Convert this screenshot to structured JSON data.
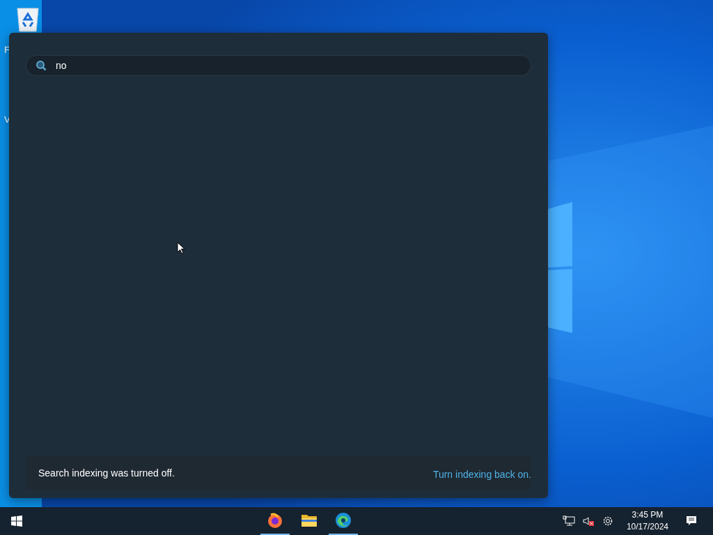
{
  "desktop": {
    "icons": [
      {
        "label": "F"
      },
      {
        "label": "V"
      }
    ]
  },
  "search_panel": {
    "query": "no",
    "notice": "Search indexing was turned off.",
    "link": "Turn indexing back on."
  },
  "taskbar": {
    "apps": [
      {
        "kind": "firefox",
        "running": true
      },
      {
        "kind": "files",
        "running": false
      },
      {
        "kind": "edge",
        "running": true
      }
    ],
    "volume_muted": true,
    "clock": {
      "time": "3:45 PM",
      "date": "10/17/2024"
    }
  }
}
